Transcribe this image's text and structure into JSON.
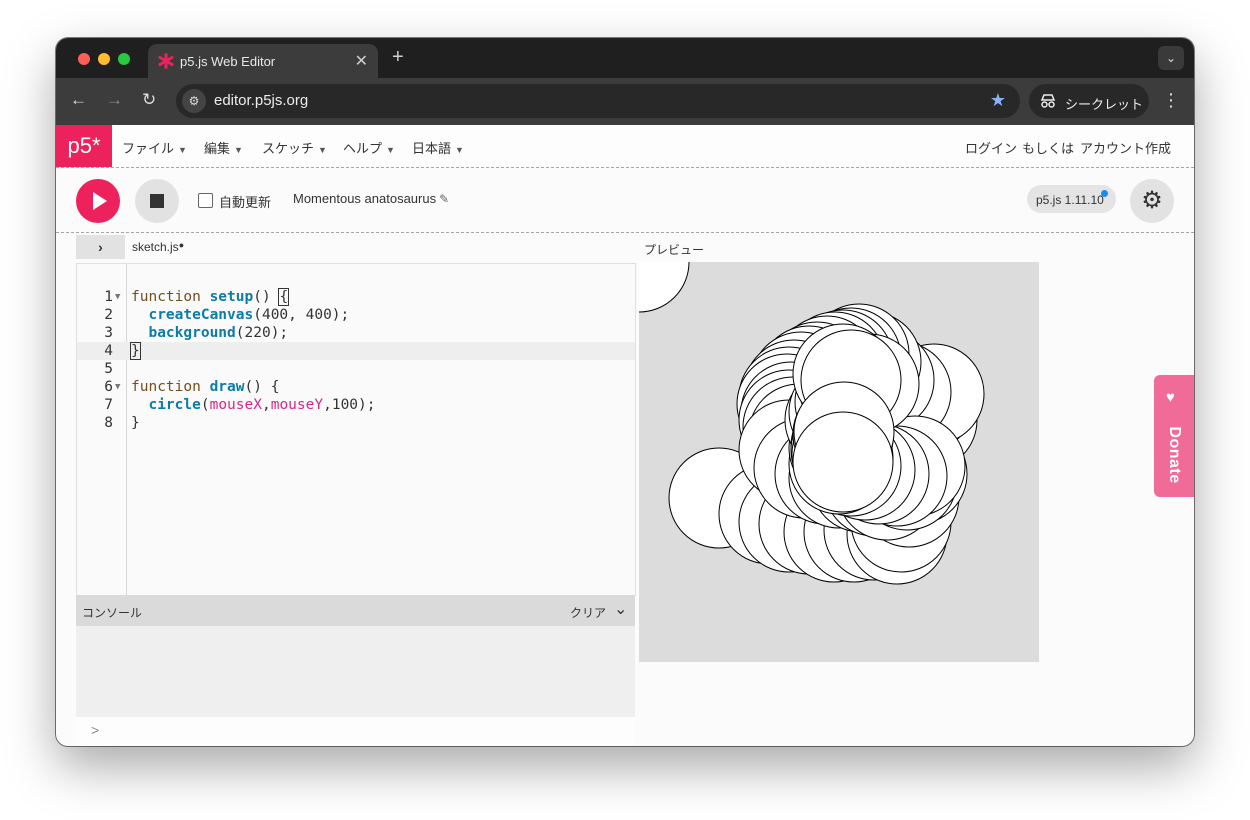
{
  "browser": {
    "tab": {
      "title": "p5.js Web Editor",
      "close": "✕"
    },
    "new_tab": "+",
    "url": "editor.p5js.org",
    "incognito_label": "シークレット"
  },
  "editor": {
    "logo": "p5*",
    "menu": [
      "ファイル",
      "編集",
      "スケッチ",
      "ヘルプ",
      "日本語"
    ],
    "menu_caret": "▼",
    "account": {
      "login": "ログイン",
      "or": "もしくは",
      "signup": "アカウント作成"
    },
    "auto_refresh_label": "自動更新",
    "auto_refresh_checked": false,
    "sketch_name": "Momentous anatosaurus",
    "version": "p5.js 1.11.10",
    "file": {
      "name": "sketch.js",
      "unsaved_marker": "●"
    },
    "preview_label": "プレビュー",
    "code_lines": [
      {
        "n": "1",
        "text": "function setup() {"
      },
      {
        "n": "2",
        "text": "  createCanvas(400, 400);"
      },
      {
        "n": "3",
        "text": "  background(220);"
      },
      {
        "n": "4",
        "text": "}"
      },
      {
        "n": "5",
        "text": ""
      },
      {
        "n": "6",
        "text": "function draw() {"
      },
      {
        "n": "7",
        "text": "  circle(mouseX,mouseY,100);"
      },
      {
        "n": "8",
        "text": "}"
      }
    ],
    "console": {
      "title": "コンソール",
      "clear": "クリア",
      "prompt": ">"
    },
    "donate_label": "Donate"
  },
  "colors": {
    "brand": "#ed225d",
    "donate": "#f06b98",
    "canvas_bg": "#dcdcdc",
    "version_dot": "#1a8bf0"
  }
}
